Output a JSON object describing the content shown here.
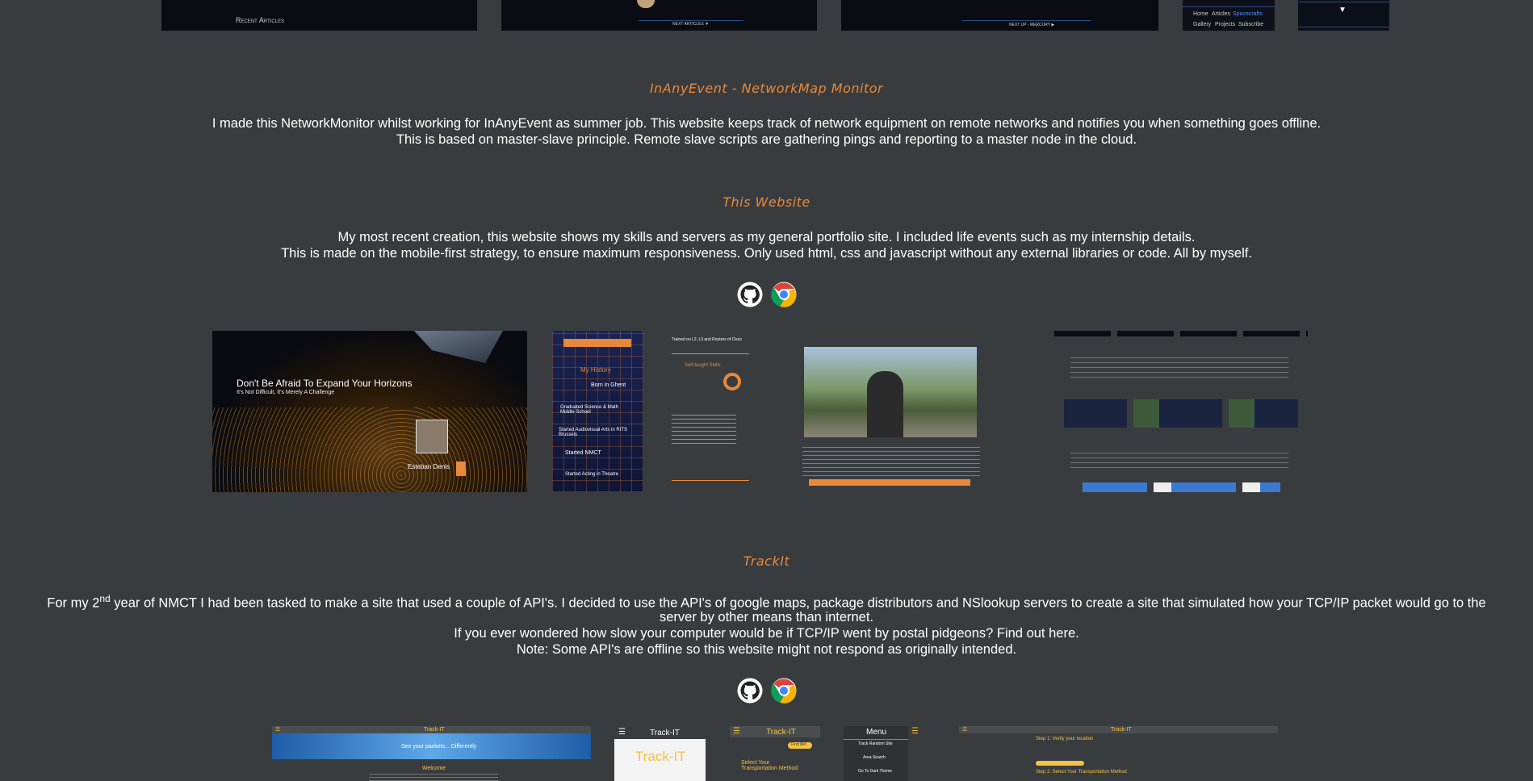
{
  "top_strip": {
    "recent_articles": "Recent Articles",
    "next_articles": "NEXT ARTICLES ▼",
    "next_up": "NEXT UP - MERCURY ▶",
    "nav": [
      "Home",
      "Articles",
      "Spacecrafts",
      "Gallery",
      "Projects",
      "Subscribe"
    ],
    "arrow": "▼"
  },
  "sections": [
    {
      "title": "InAnyEvent - NetworkMap Monitor",
      "lines": [
        "I made this NetworkMonitor whilst working for InAnyEvent as summer job. This website keeps track of network equipment on remote networks and notifies you when something goes offline.",
        "This is based on master-slave principle. Remote slave scripts are gathering pings and reporting to a master node in the cloud."
      ]
    },
    {
      "title": "This Website",
      "lines": [
        "My most recent creation, this website shows my skills and servers as my general portfolio site. I included life events such as my internship details.",
        "This is made on the mobile-first strategy, to ensure maximum responsiveness. Only used html, css and javascript without any external libraries or code. All by myself."
      ],
      "shots": {
        "hero_title": "Don't Be Afraid To Expand Your Horizons",
        "hero_sub": "It's Not Difficult, It's Merely A Challenge",
        "hero_name": "Esteban Denis",
        "history_label": "My History",
        "history_items": [
          "Born in Ghent",
          "Graduated Science & Math Middle School",
          "Started Audiovisual Arts in RITS Brussels",
          "Started NMCT",
          "Started Acting in Theatre"
        ],
        "skills_label": "Self-taught Skills",
        "trained": "Trained on L2, L3 and Routers of Cisco"
      }
    },
    {
      "title": "TrackIt",
      "line1_pre": "For my 2",
      "line1_sup": "nd",
      "line1_post": " year of NMCT I had been tasked to make a site that used a couple of API's. I decided to use the API's of google maps, package distributors and NSlookup servers to create a site that simulated how your TCP/IP packet would go to the",
      "line2": "server by other means than internet.",
      "line3": "If you ever wondered how slow your computer would be if TCP/IP went by postal pidgeons? Find out here.",
      "line4": "Note: Some API's are offline so this website might not respond as originally intended.",
      "shots": {
        "app_name": "Track-IT",
        "tagline": "See your packets... Differently",
        "welcome": "Welcome",
        "menu": "Menu",
        "menu_items": [
          "Track Random Site",
          "Area Search",
          "Go To Dark Theme"
        ],
        "transport": "Select Your Transportation Method",
        "find_me": "Find Me!",
        "step1": "Step 1: Verify your location",
        "step2": "Step 2: Select Your Transportation Method"
      }
    }
  ],
  "colors": {
    "background": "#393c3f",
    "accent": "#e8883a",
    "text": "#ffffff"
  }
}
